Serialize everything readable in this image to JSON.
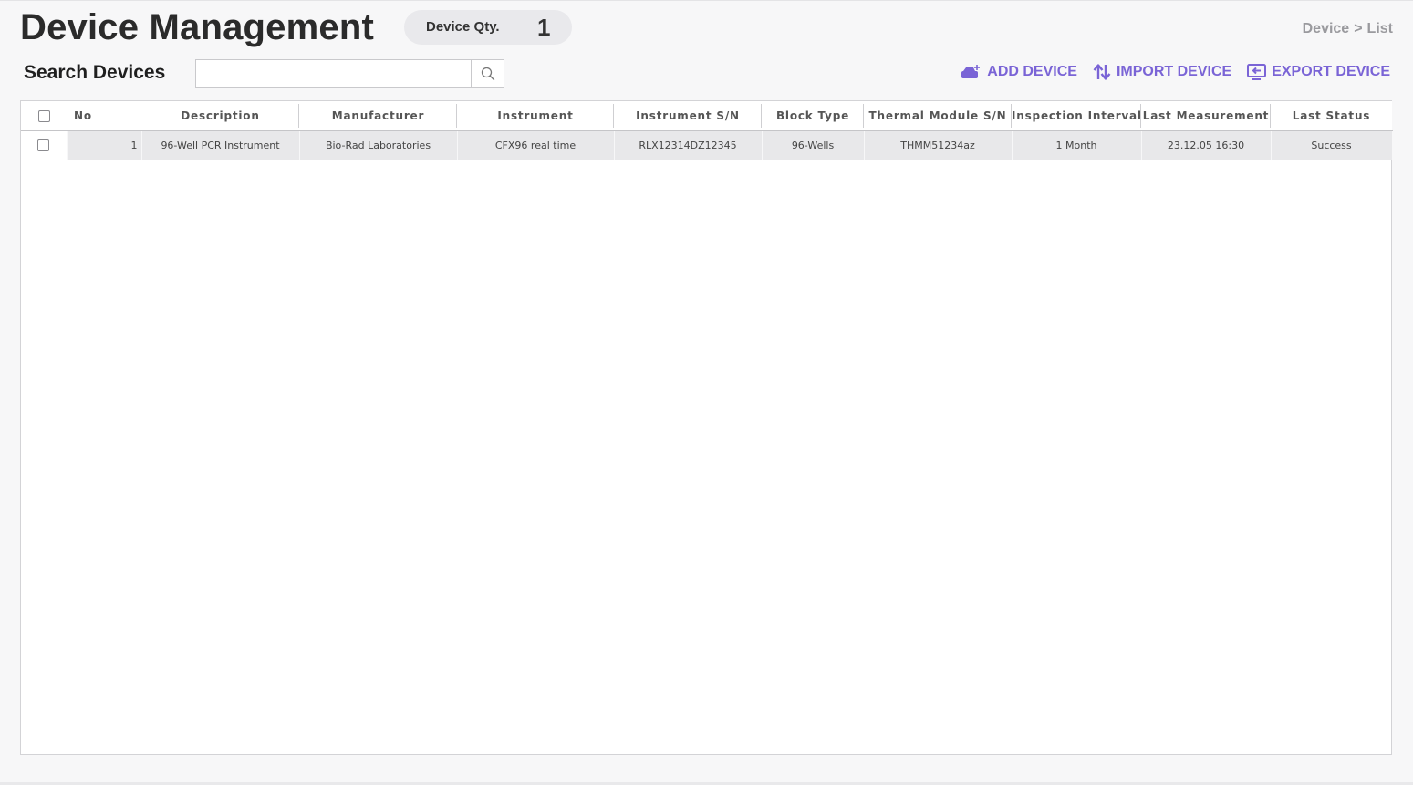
{
  "header": {
    "title": "Device Management",
    "qty_label": "Device Qty.",
    "qty_value": "1",
    "breadcrumb": [
      "Device",
      ">",
      "List"
    ]
  },
  "search": {
    "label": "Search Devices",
    "value": "",
    "placeholder": ""
  },
  "actions": {
    "add": "ADD DEVICE",
    "import": "IMPORT DEVICE",
    "export": "EXPORT DEVICE"
  },
  "colors": {
    "accent": "#7a64d6",
    "row_bg": "#e8e8ea"
  },
  "table": {
    "columns": [
      "No",
      "Description",
      "Manufacturer",
      "Instrument",
      "Instrument S/N",
      "Block Type",
      "Thermal Module S/N",
      "Inspection Interval",
      "Last Measurement",
      "Last Status"
    ],
    "rows": [
      {
        "checked": false,
        "cells": [
          "1",
          "96-Well PCR Instrument",
          "Bio-Rad Laboratories",
          "CFX96 real time",
          "RLX12314DZ12345",
          "96-Wells",
          "THMM51234az",
          "1 Month",
          "23.12.05 16:30",
          "Success"
        ]
      }
    ]
  }
}
